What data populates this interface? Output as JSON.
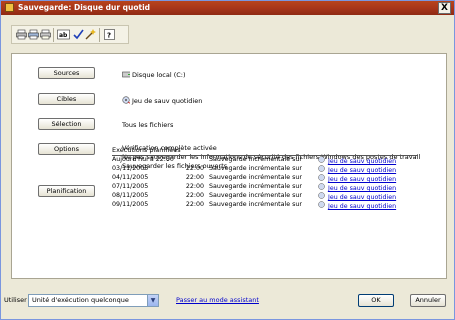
{
  "window": {
    "title": "Sauvegarde: Disque dur quotid",
    "close_glyph": "X"
  },
  "toolbar": {
    "icons": [
      "printer-icon",
      "print-preview-icon",
      "print-setup-icon",
      "rename-icon",
      "check-icon",
      "wizard-icon",
      "help-icon"
    ]
  },
  "rows": {
    "sources": {
      "button": "Sources",
      "value": "Disque local (C:)"
    },
    "cibles": {
      "button": "Cibles",
      "value": "Jeu de sauv quotidien"
    },
    "selection": {
      "button": "Sélection",
      "value": "Tous les fichiers"
    },
    "options": {
      "button": "Options",
      "lines": [
        "Vérification complète activée",
        "Ne pas sauvegarder les informations de sécurité des fichiers Windows des postes de travail",
        "Sauvegarder les fichiers ouverts"
      ]
    },
    "planification": {
      "button": "Planification",
      "header": "Exécutions planifiées"
    }
  },
  "executions": [
    {
      "date": "Aujourd'hui à 22:00",
      "time": "",
      "desc": "Sauvegarde incrémentale sur",
      "target": "Jeu de sauv quotidien"
    },
    {
      "date": "03/11/2005",
      "time": "22:00",
      "desc": "Sauvegarde incrémentale sur",
      "target": "Jeu de sauv quotidien"
    },
    {
      "date": "04/11/2005",
      "time": "22:00",
      "desc": "Sauvegarde incrémentale sur",
      "target": "Jeu de sauv quotidien"
    },
    {
      "date": "07/11/2005",
      "time": "22:00",
      "desc": "Sauvegarde incrémentale sur",
      "target": "Jeu de sauv quotidien"
    },
    {
      "date": "08/11/2005",
      "time": "22:00",
      "desc": "Sauvegarde incrémentale sur",
      "target": "Jeu de sauv quotidien"
    },
    {
      "date": "09/11/2005",
      "time": "22:00",
      "desc": "Sauvegarde incrémentale sur",
      "target": "Jeu de sauv quotidien"
    }
  ],
  "footer": {
    "use_label": "Utiliser",
    "use_value": "Unité d'exécution quelconque",
    "assistant_link": "Passer au mode assistant",
    "ok": "OK",
    "cancel": "Annuler"
  },
  "colors": {
    "titlebar": "#a8361a",
    "link": "#0000cc",
    "background": "#ece9d8"
  }
}
